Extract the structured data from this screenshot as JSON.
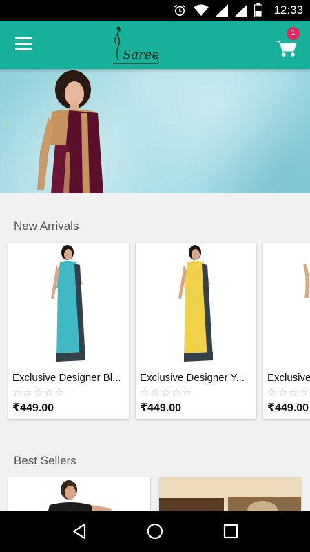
{
  "status_bar": {
    "time": "12:33"
  },
  "app_bar": {
    "logo_text": "Saree",
    "cart_count": "1"
  },
  "banner": {
    "dots": 3,
    "active_dot": 0
  },
  "sections": {
    "new_arrivals": "New Arrivals",
    "best_sellers": "Best Sellers"
  },
  "products": [
    {
      "name": "Exclusive Designer Bl...",
      "price": "₹449.00",
      "rating": 0,
      "saree_color": "#3fb9c4"
    },
    {
      "name": "Exclusive Designer Y...",
      "price": "₹449.00",
      "rating": 0,
      "saree_color": "#f0d24a"
    },
    {
      "name": "Exclusive",
      "price": "₹449.00",
      "rating": 0,
      "saree_color": "#d9a980"
    }
  ],
  "colors": {
    "primary": "#17b09b",
    "badge": "#e8245c",
    "banner_saree": "#5a0f2a",
    "border_saree": "#c4935e"
  }
}
